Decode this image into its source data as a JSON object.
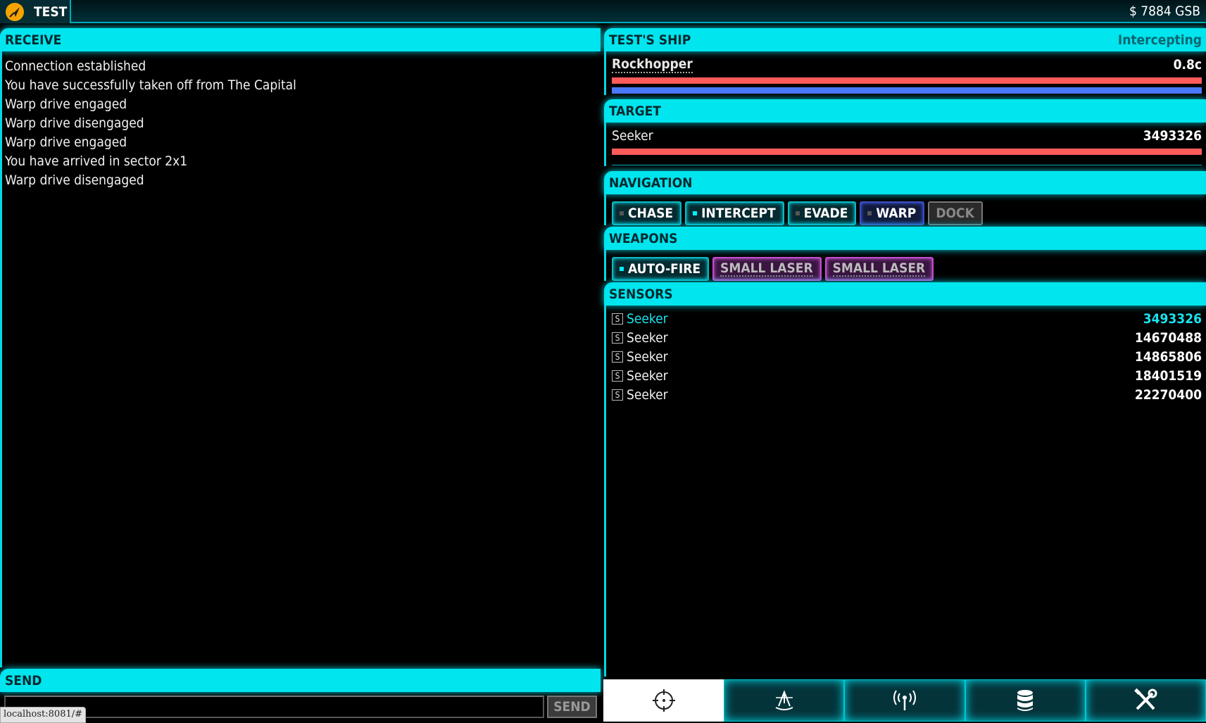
{
  "app": {
    "name": "TEST",
    "balance": "$ 7884 GSB"
  },
  "receive": {
    "title": "RECEIVE",
    "messages": [
      "Connection established",
      "You have successfully taken off from The Capital",
      "Warp drive engaged",
      "Warp drive disengaged",
      "Warp drive engaged",
      "You have arrived in sector 2x1",
      "Warp drive disengaged"
    ]
  },
  "send": {
    "title": "SEND",
    "input_value": "",
    "button_label": "SEND"
  },
  "status_url": "localhost:8081/#",
  "ship": {
    "title": "TEST'S SHIP",
    "status": "Intercepting",
    "name": "Rockhopper",
    "speed": "0.8c",
    "hull_pct": 100,
    "shield_pct": 100
  },
  "target": {
    "title": "TARGET",
    "name": "Seeker",
    "id": "3493326",
    "hull_pct": 100
  },
  "navigation": {
    "title": "NAVIGATION",
    "buttons": [
      {
        "label": "CHASE",
        "active": false
      },
      {
        "label": "INTERCEPT",
        "active": true
      },
      {
        "label": "EVADE",
        "active": false
      },
      {
        "label": "WARP",
        "active": false
      },
      {
        "label": "DOCK",
        "disabled": true
      }
    ]
  },
  "weapons": {
    "title": "WEAPONS",
    "autofire": {
      "label": "AUTO-FIRE",
      "active": true
    },
    "lasers": [
      "SMALL LASER",
      "SMALL LASER"
    ]
  },
  "sensors": {
    "title": "SENSORS",
    "items": [
      {
        "tag": "S",
        "name": "Seeker",
        "id": "3493326",
        "selected": true
      },
      {
        "tag": "S",
        "name": "Seeker",
        "id": "14670488"
      },
      {
        "tag": "S",
        "name": "Seeker",
        "id": "14865806"
      },
      {
        "tag": "S",
        "name": "Seeker",
        "id": "18401519"
      },
      {
        "tag": "S",
        "name": "Seeker",
        "id": "22270400"
      }
    ]
  },
  "tabs": [
    {
      "icon": "crosshair-icon",
      "active": true
    },
    {
      "icon": "sextant-icon"
    },
    {
      "icon": "antenna-icon"
    },
    {
      "icon": "database-icon"
    },
    {
      "icon": "tools-icon"
    }
  ],
  "colors": {
    "accent": "#00e5ee",
    "red_bar": "#ff5b5b",
    "blue_bar": "#4a78ff",
    "laser": "#c34cd0",
    "selected": "#19e3f0"
  }
}
